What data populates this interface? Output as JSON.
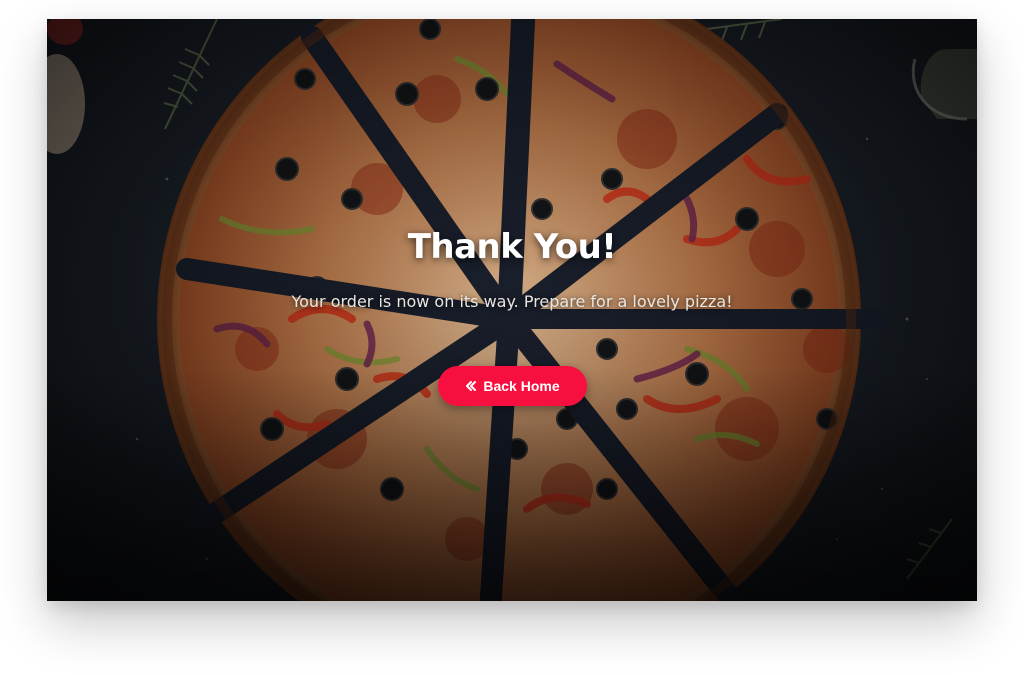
{
  "hero": {
    "title": "Thank You!",
    "message": "Your order is now on its way. Prepare for a lovely pizza!"
  },
  "actions": {
    "back_home_label": "Back Home",
    "back_home_icon": "double-chevron-left-icon"
  },
  "colors": {
    "button_background": "#f7103f",
    "button_text": "#ffffff",
    "title_text": "#ffffff",
    "background_surface": "#1a2029"
  }
}
